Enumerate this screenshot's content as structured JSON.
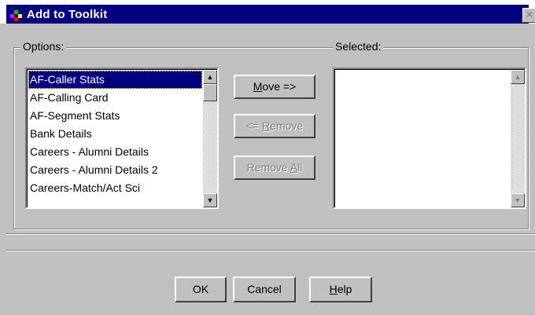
{
  "window": {
    "title": "Add to Toolkit",
    "close_glyph": "✕"
  },
  "options": {
    "label": "Options:",
    "items": [
      "AF-Caller Stats",
      "AF-Calling Card",
      "AF-Segment Stats",
      "Bank Details",
      "Careers - Alumni Details",
      "Careers - Alumni Details 2",
      "Careers-Match/Act Sci"
    ],
    "selected_index": 0
  },
  "selected": {
    "label": "Selected:",
    "items": []
  },
  "actions": {
    "move": {
      "mnemonic": "M",
      "rest": "ove =>"
    },
    "remove": {
      "pre": "<= ",
      "mnemonic": "R",
      "rest": "emove"
    },
    "remove_all": {
      "pre": "Remove ",
      "mnemonic": "A",
      "rest": "ll"
    }
  },
  "footer": {
    "ok": "OK",
    "cancel": "Cancel",
    "help": {
      "mnemonic": "H",
      "rest": "elp"
    }
  },
  "scroll_glyphs": {
    "up": "▲",
    "down": "▼"
  }
}
